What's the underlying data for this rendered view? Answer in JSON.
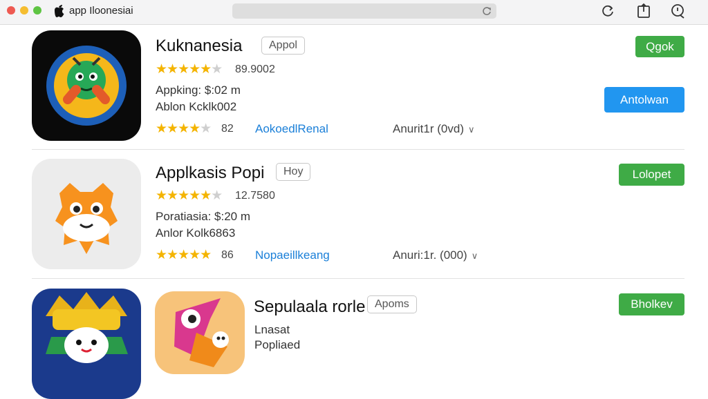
{
  "window": {
    "title": "app Iloonesiai"
  },
  "apps": [
    {
      "name": "Kuknanesia",
      "tag": "Appol",
      "rating_value": "89.9002",
      "price_text": "Appking: $:02 m",
      "author_text": "Ablon Kcklk002",
      "stars_row2": "82",
      "link_text": "AokoedlRenal",
      "version_text": "Anurit1r (0vd)",
      "button_top": "Qgok",
      "button_mid": "Antolwan"
    },
    {
      "name": "Applkasis Popi",
      "tag": "Hoy",
      "rating_value": "12.7580",
      "price_text": "Poratiasia: $:20 m",
      "author_text": "Anlor Kolk6863",
      "stars_row2": "86",
      "link_text": "Nopaeillkeang",
      "version_text": "Anuri:1r. (000)",
      "button_top": "Lolopet"
    },
    {
      "name": "Sepulaala rorle",
      "tag": "Apoms",
      "price_text": "Lnasat",
      "author_text": "Popliaed",
      "button_top": "Bholkev"
    }
  ]
}
